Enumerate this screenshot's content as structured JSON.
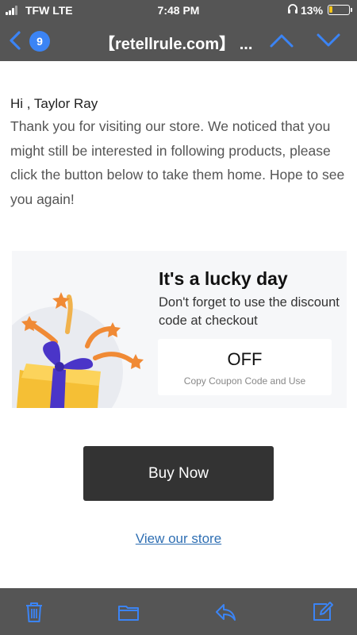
{
  "status_bar": {
    "carrier": "TFW  LTE",
    "time": "7:48 PM",
    "battery_percent": "13%",
    "battery_level": 0.13
  },
  "nav": {
    "unread_count": "9",
    "subject": "【retellrule.com】 ...",
    "accent_color": "#3b84f5"
  },
  "email": {
    "greeting": "Hi , Taylor Ray",
    "message": "Thank you for visiting our store. We noticed that you might still be interested in following products, please click the button below to take them home. Hope to see you again!",
    "promo": {
      "title": "It's a lucky day",
      "description": "Don't forget to use the discount code at checkout",
      "coupon_code": "OFF",
      "coupon_hint": "Copy Coupon Code and Use"
    },
    "buy_button": "Buy Now",
    "store_link": "View our store"
  },
  "toolbar": {
    "icons": [
      "trash-icon",
      "folder-icon",
      "reply-icon",
      "compose-icon"
    ],
    "icon_color": "#3b84f5"
  }
}
